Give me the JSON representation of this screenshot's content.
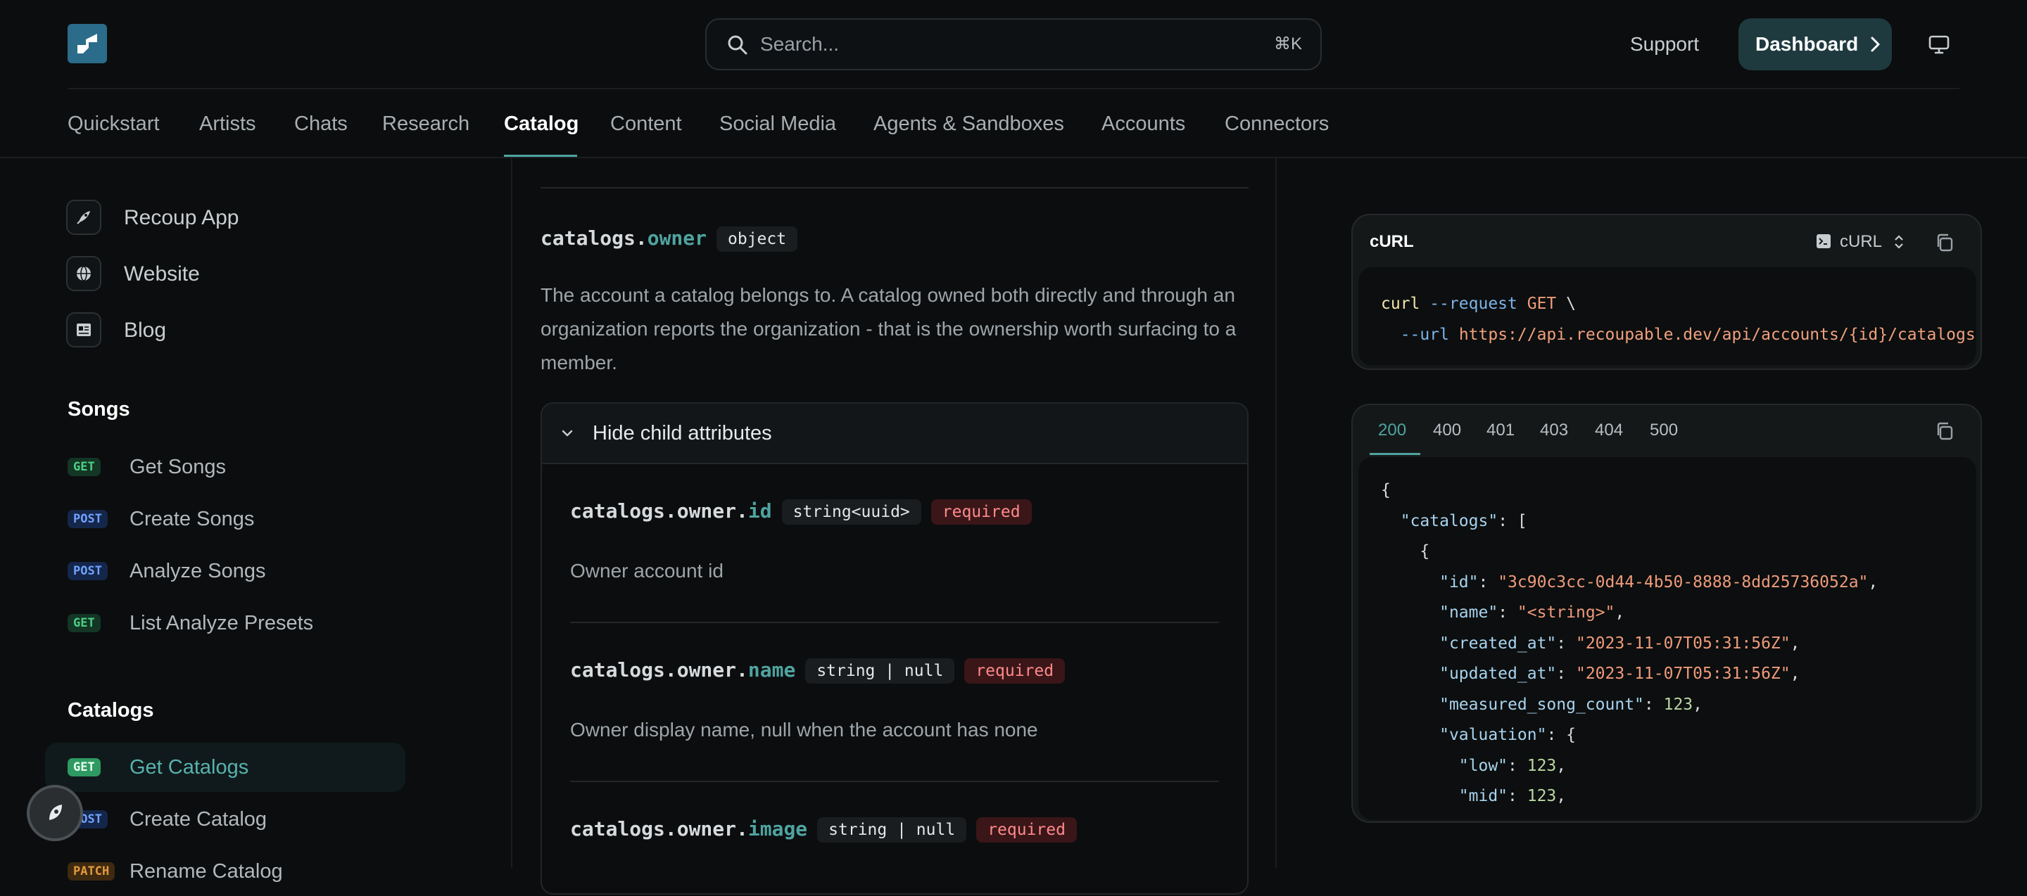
{
  "header": {
    "logo_alt": "Recoup logo",
    "search_placeholder": "Search...",
    "search_shortcut": "⌘K",
    "support_label": "Support",
    "dashboard_label": "Dashboard"
  },
  "tabs": [
    {
      "label": "Quickstart",
      "active": false
    },
    {
      "label": "Artists",
      "active": false
    },
    {
      "label": "Chats",
      "active": false
    },
    {
      "label": "Research",
      "active": false
    },
    {
      "label": "Catalog",
      "active": true
    },
    {
      "label": "Content",
      "active": false
    },
    {
      "label": "Social Media",
      "active": false
    },
    {
      "label": "Agents & Sandboxes",
      "active": false
    },
    {
      "label": "Accounts",
      "active": false
    },
    {
      "label": "Connectors",
      "active": false
    }
  ],
  "sidebar": {
    "links": [
      {
        "label": "Recoup App",
        "icon": "rocket-icon"
      },
      {
        "label": "Website",
        "icon": "globe-icon"
      },
      {
        "label": "Blog",
        "icon": "newspaper-icon"
      }
    ],
    "sections": [
      {
        "heading": "Songs",
        "items": [
          {
            "method": "GET",
            "label": "Get Songs"
          },
          {
            "method": "POST",
            "label": "Create Songs"
          },
          {
            "method": "POST",
            "label": "Analyze Songs"
          },
          {
            "method": "GET",
            "label": "List Analyze Presets"
          }
        ]
      },
      {
        "heading": "Catalogs",
        "items": [
          {
            "method": "GET",
            "label": "Get Catalogs",
            "active": true
          },
          {
            "method": "POST",
            "label": "Create Catalog"
          },
          {
            "method": "PATCH",
            "label": "Rename Catalog"
          }
        ]
      }
    ]
  },
  "content": {
    "owner_param": {
      "prefix": "catalogs.",
      "name": "owner",
      "type": "object",
      "description": "The account a catalog belongs to. A catalog owned both directly and through an organization reports the organization - that is the ownership worth surfacing to a member."
    },
    "child_toggle_label": "Hide child attributes",
    "child_params": [
      {
        "prefix": "catalogs.owner.",
        "name": "id",
        "type": "string<uuid>",
        "required": "required",
        "description": "Owner account id"
      },
      {
        "prefix": "catalogs.owner.",
        "name": "name",
        "type": "string | null",
        "required": "required",
        "description": "Owner display name, null when the account has none"
      },
      {
        "prefix": "catalogs.owner.",
        "name": "image",
        "type": "string | null",
        "required": "required",
        "description": ""
      }
    ]
  },
  "request_panel": {
    "title": "cURL",
    "language": "cURL",
    "code_line1": {
      "cmd": "curl",
      "flag": "--request",
      "method": "GET",
      "cont": "\\"
    },
    "code_line2": {
      "flag": "--url",
      "url": "https://api.recoupable.dev/api/accounts/{id}/catalogs"
    }
  },
  "response_panel": {
    "status_tabs": [
      {
        "label": "200",
        "active": true
      },
      {
        "label": "400",
        "active": false
      },
      {
        "label": "401",
        "active": false
      },
      {
        "label": "403",
        "active": false
      },
      {
        "label": "404",
        "active": false
      },
      {
        "label": "500",
        "active": false
      }
    ],
    "json": {
      "root_key": "catalogs",
      "id": "3c90c3cc-0d44-4b50-8888-8dd25736052a",
      "name": "<string>",
      "created_at": "2023-11-07T05:31:56Z",
      "updated_at": "2023-11-07T05:31:56Z",
      "measured_song_count": 123,
      "valuation_key": "valuation",
      "low": 123,
      "mid": 123
    }
  },
  "colors": {
    "accent": "#4fa3a0",
    "get_badge": "#4ccf85",
    "post_badge": "#71a2ff",
    "required": "#ff8a8a"
  }
}
